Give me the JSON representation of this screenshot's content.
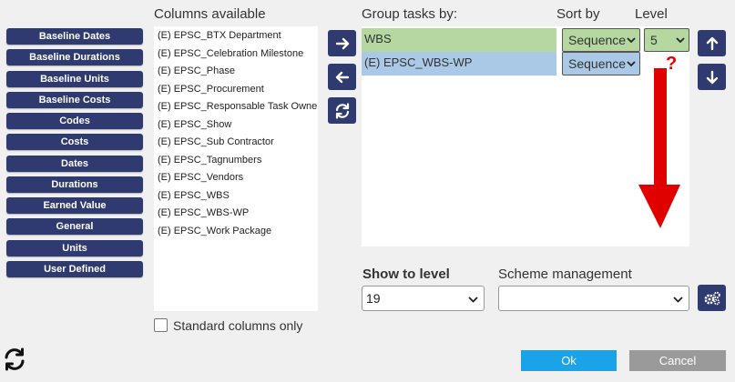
{
  "categories": [
    {
      "label": "Baseline Dates"
    },
    {
      "label": "Baseline Durations"
    },
    {
      "label": "Baseline Units"
    },
    {
      "label": "Baseline Costs"
    },
    {
      "label": "Codes"
    },
    {
      "label": "Costs"
    },
    {
      "label": "Dates"
    },
    {
      "label": "Durations"
    },
    {
      "label": "Earned Value"
    },
    {
      "label": "General"
    },
    {
      "label": "Units"
    },
    {
      "label": "User Defined"
    }
  ],
  "columns_available": {
    "header": "Columns available",
    "items": [
      "(E) EPSC_BTX Department",
      "(E) EPSC_Celebration Milestone",
      "(E) EPSC_Phase",
      "(E) EPSC_Procurement",
      "(E) EPSC_Responsable Task Owner",
      "(E) EPSC_Show",
      "(E) EPSC_Sub Contractor",
      "(E) EPSC_Tagnumbers",
      "(E) EPSC_Vendors",
      "(E) EPSC_WBS",
      "(E) EPSC_WBS-WP",
      "(E) EPSC_Work Package"
    ]
  },
  "standard_columns": {
    "label": "Standard columns only"
  },
  "group": {
    "header": "Group tasks by:",
    "sort_header": "Sort by",
    "level_header": "Level",
    "rows": [
      {
        "label": "WBS",
        "sort": "Sequence",
        "level": "5",
        "color": "#b5d7a0"
      },
      {
        "label": "(E) EPSC_WBS-WP",
        "sort": "Sequence",
        "color": "#a9c9e6"
      }
    ],
    "annotation": "?"
  },
  "show_level": {
    "label": "Show to level",
    "value": "19"
  },
  "scheme": {
    "label": "Scheme management",
    "value": ""
  },
  "buttons": {
    "ok": "Ok",
    "cancel": "Cancel"
  },
  "colors": {
    "accent": "#2e3a70",
    "ok": "#1aa3e8",
    "cancel": "#9a9a9a",
    "arrow": "#e00000"
  }
}
